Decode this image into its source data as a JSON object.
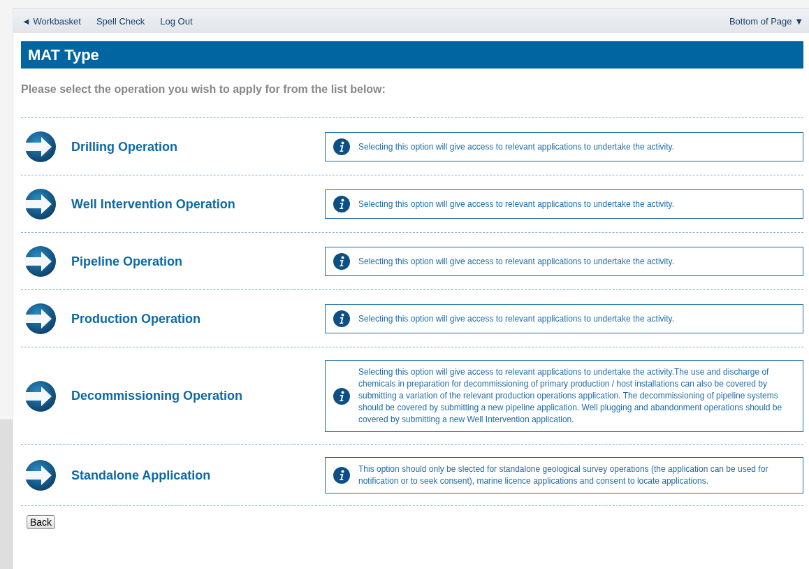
{
  "nav": {
    "links": [
      "◄ Workbasket",
      "Spell Check",
      "Log Out"
    ],
    "right_link": "Bottom of Page ▼"
  },
  "title": "MAT Type",
  "instruction": "Please select the operation you wish to apply for from the list below:",
  "options": [
    {
      "label": "Drilling Operation",
      "info": "Selecting this option will give access to relevant applications to undertake the activity."
    },
    {
      "label": "Well Intervention Operation",
      "info": "Selecting this option will give access to relevant applications to undertake the activity."
    },
    {
      "label": "Pipeline Operation",
      "info": "Selecting this option will give access to relevant applications to undertake the activity."
    },
    {
      "label": "Production Operation",
      "info": "Selecting this option will give access to relevant applications to undertake the activity."
    },
    {
      "label": "Decommissioning Operation",
      "info": "Selecting this option will give access to relevant applications to undertake the activity.The use and discharge of chemicals in preparation for decommissioning of primary production / host installations can also be covered by submitting a variation of the relevant production operations application. The decommissioning of pipeline systems should be covered by submitting a new pipeline application. Well plugging and abandonment operations should be covered by submitting a new Well Intervention application."
    },
    {
      "label": "Standalone Application",
      "info": "This option should only be slected for standalone geological survey operations (the application can be used for notification or to seek consent), marine licence applications and consent to locate applications."
    }
  ],
  "back_button": "Back"
}
